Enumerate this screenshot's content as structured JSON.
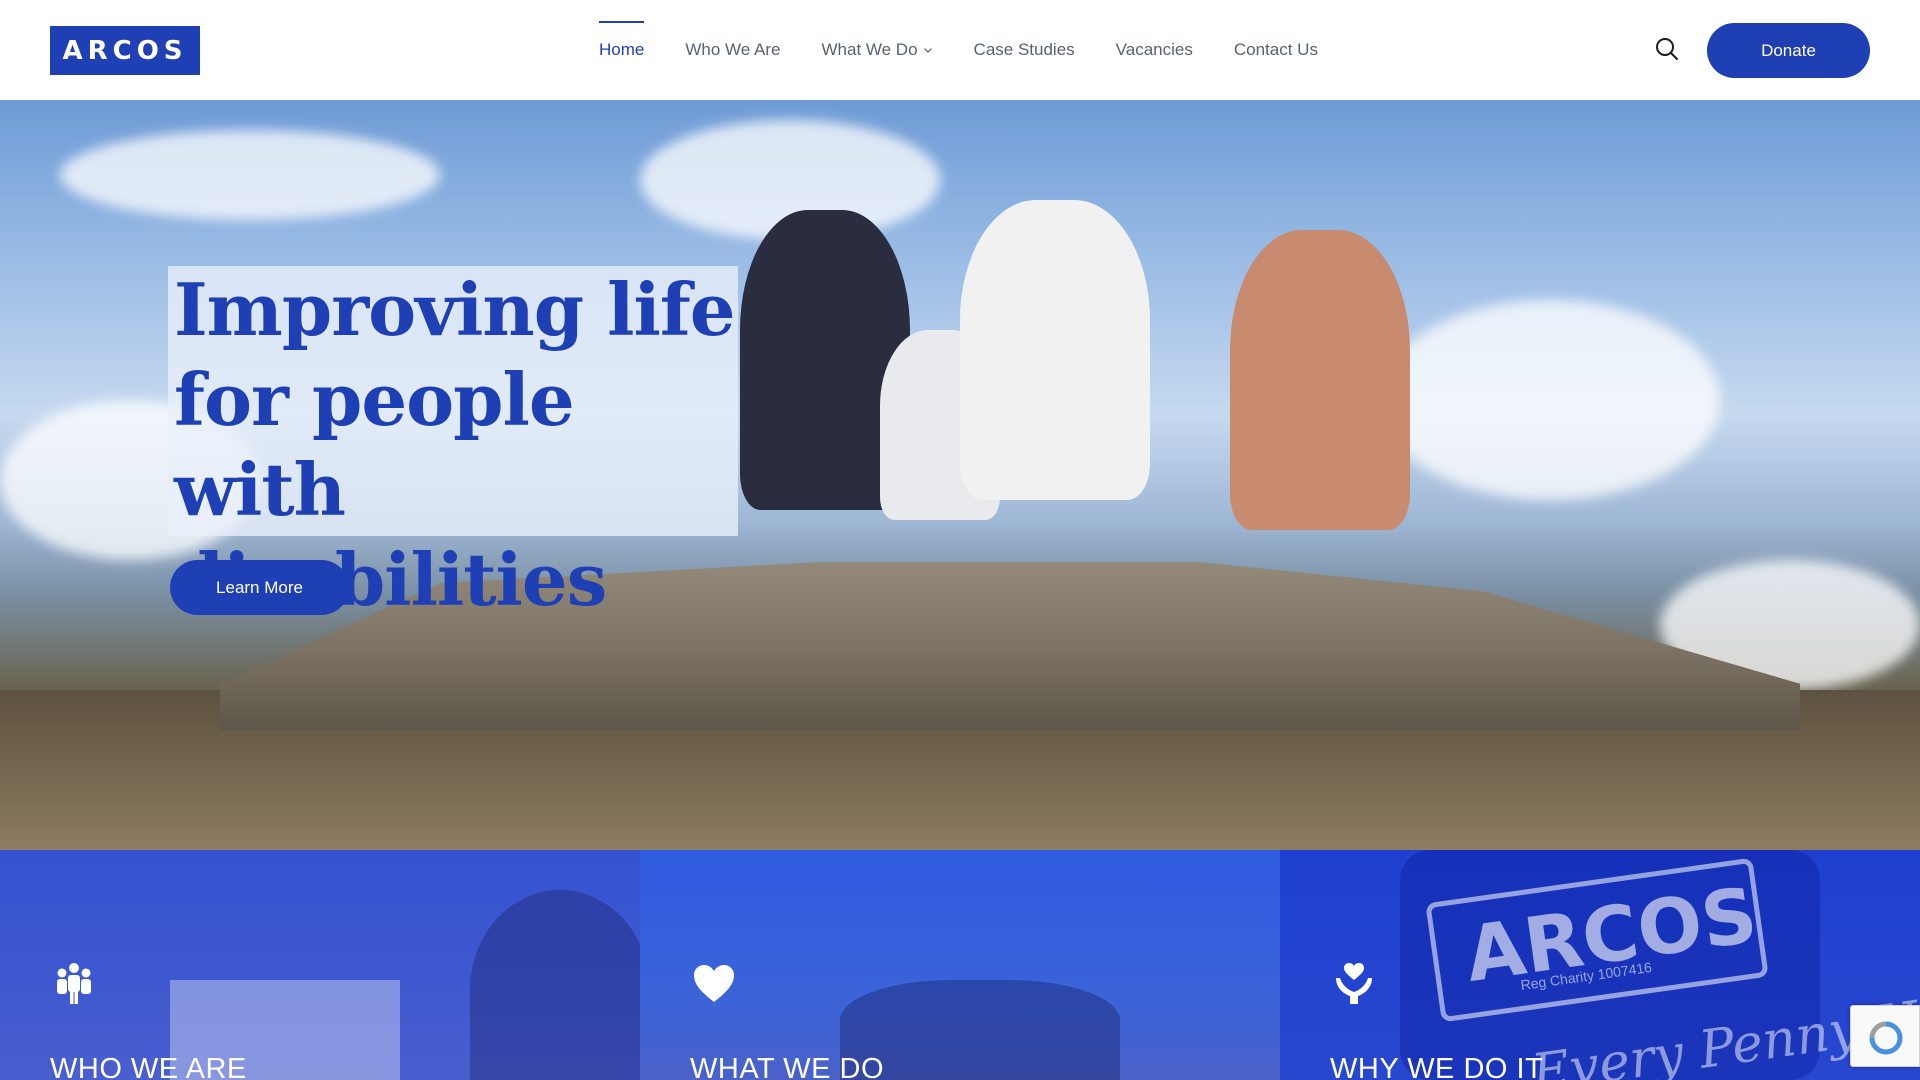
{
  "header": {
    "logo_text": "ARCOS",
    "nav": [
      {
        "label": "Home",
        "active": true
      },
      {
        "label": "Who We Are",
        "active": false
      },
      {
        "label": "What We Do",
        "active": false,
        "has_dropdown": true
      },
      {
        "label": "Case Studies",
        "active": false
      },
      {
        "label": "Vacancies",
        "active": false
      },
      {
        "label": "Contact Us",
        "active": false
      }
    ],
    "search_icon": "search-icon",
    "donate_label": "Donate"
  },
  "hero": {
    "title_lines": [
      "Improving life",
      "for people with",
      "disabilities"
    ],
    "cta_label": "Learn More"
  },
  "panels": [
    {
      "title": "WHO WE ARE",
      "icon": "people-icon"
    },
    {
      "title": "WHAT WE DO",
      "icon": "heart-icon"
    },
    {
      "title": "WHY WE DO IT",
      "icon": "caring-hands-icon",
      "photo_text": {
        "brand": "ARCOS",
        "reg": "Reg Charity 1007416",
        "slogan": "Every Penny Helps"
      }
    }
  ],
  "colors": {
    "brand": "#1f3fb5",
    "text_nav": "#5a6170",
    "white": "#ffffff"
  }
}
